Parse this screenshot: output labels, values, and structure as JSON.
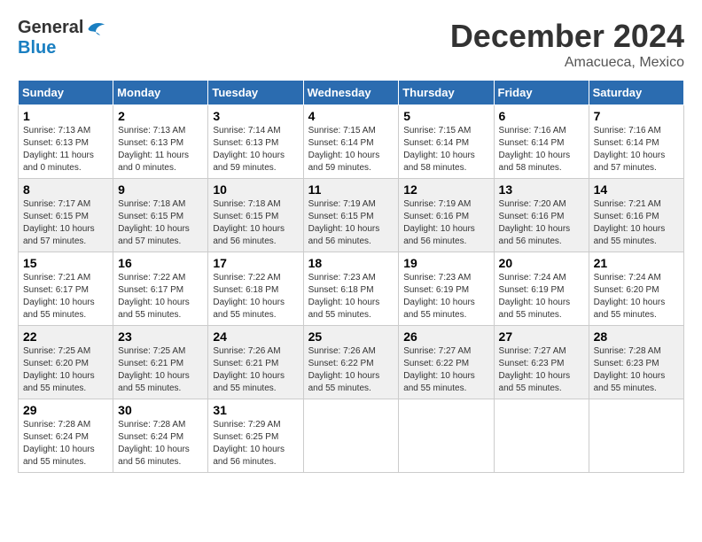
{
  "header": {
    "logo_general": "General",
    "logo_blue": "Blue",
    "title": "December 2024",
    "location": "Amacueca, Mexico"
  },
  "weekdays": [
    "Sunday",
    "Monday",
    "Tuesday",
    "Wednesday",
    "Thursday",
    "Friday",
    "Saturday"
  ],
  "weeks": [
    [
      {
        "day": "1",
        "sunrise": "Sunrise: 7:13 AM",
        "sunset": "Sunset: 6:13 PM",
        "daylight": "Daylight: 11 hours and 0 minutes."
      },
      {
        "day": "2",
        "sunrise": "Sunrise: 7:13 AM",
        "sunset": "Sunset: 6:13 PM",
        "daylight": "Daylight: 11 hours and 0 minutes."
      },
      {
        "day": "3",
        "sunrise": "Sunrise: 7:14 AM",
        "sunset": "Sunset: 6:13 PM",
        "daylight": "Daylight: 10 hours and 59 minutes."
      },
      {
        "day": "4",
        "sunrise": "Sunrise: 7:15 AM",
        "sunset": "Sunset: 6:14 PM",
        "daylight": "Daylight: 10 hours and 59 minutes."
      },
      {
        "day": "5",
        "sunrise": "Sunrise: 7:15 AM",
        "sunset": "Sunset: 6:14 PM",
        "daylight": "Daylight: 10 hours and 58 minutes."
      },
      {
        "day": "6",
        "sunrise": "Sunrise: 7:16 AM",
        "sunset": "Sunset: 6:14 PM",
        "daylight": "Daylight: 10 hours and 58 minutes."
      },
      {
        "day": "7",
        "sunrise": "Sunrise: 7:16 AM",
        "sunset": "Sunset: 6:14 PM",
        "daylight": "Daylight: 10 hours and 57 minutes."
      }
    ],
    [
      {
        "day": "8",
        "sunrise": "Sunrise: 7:17 AM",
        "sunset": "Sunset: 6:15 PM",
        "daylight": "Daylight: 10 hours and 57 minutes."
      },
      {
        "day": "9",
        "sunrise": "Sunrise: 7:18 AM",
        "sunset": "Sunset: 6:15 PM",
        "daylight": "Daylight: 10 hours and 57 minutes."
      },
      {
        "day": "10",
        "sunrise": "Sunrise: 7:18 AM",
        "sunset": "Sunset: 6:15 PM",
        "daylight": "Daylight: 10 hours and 56 minutes."
      },
      {
        "day": "11",
        "sunrise": "Sunrise: 7:19 AM",
        "sunset": "Sunset: 6:15 PM",
        "daylight": "Daylight: 10 hours and 56 minutes."
      },
      {
        "day": "12",
        "sunrise": "Sunrise: 7:19 AM",
        "sunset": "Sunset: 6:16 PM",
        "daylight": "Daylight: 10 hours and 56 minutes."
      },
      {
        "day": "13",
        "sunrise": "Sunrise: 7:20 AM",
        "sunset": "Sunset: 6:16 PM",
        "daylight": "Daylight: 10 hours and 56 minutes."
      },
      {
        "day": "14",
        "sunrise": "Sunrise: 7:21 AM",
        "sunset": "Sunset: 6:16 PM",
        "daylight": "Daylight: 10 hours and 55 minutes."
      }
    ],
    [
      {
        "day": "15",
        "sunrise": "Sunrise: 7:21 AM",
        "sunset": "Sunset: 6:17 PM",
        "daylight": "Daylight: 10 hours and 55 minutes."
      },
      {
        "day": "16",
        "sunrise": "Sunrise: 7:22 AM",
        "sunset": "Sunset: 6:17 PM",
        "daylight": "Daylight: 10 hours and 55 minutes."
      },
      {
        "day": "17",
        "sunrise": "Sunrise: 7:22 AM",
        "sunset": "Sunset: 6:18 PM",
        "daylight": "Daylight: 10 hours and 55 minutes."
      },
      {
        "day": "18",
        "sunrise": "Sunrise: 7:23 AM",
        "sunset": "Sunset: 6:18 PM",
        "daylight": "Daylight: 10 hours and 55 minutes."
      },
      {
        "day": "19",
        "sunrise": "Sunrise: 7:23 AM",
        "sunset": "Sunset: 6:19 PM",
        "daylight": "Daylight: 10 hours and 55 minutes."
      },
      {
        "day": "20",
        "sunrise": "Sunrise: 7:24 AM",
        "sunset": "Sunset: 6:19 PM",
        "daylight": "Daylight: 10 hours and 55 minutes."
      },
      {
        "day": "21",
        "sunrise": "Sunrise: 7:24 AM",
        "sunset": "Sunset: 6:20 PM",
        "daylight": "Daylight: 10 hours and 55 minutes."
      }
    ],
    [
      {
        "day": "22",
        "sunrise": "Sunrise: 7:25 AM",
        "sunset": "Sunset: 6:20 PM",
        "daylight": "Daylight: 10 hours and 55 minutes."
      },
      {
        "day": "23",
        "sunrise": "Sunrise: 7:25 AM",
        "sunset": "Sunset: 6:21 PM",
        "daylight": "Daylight: 10 hours and 55 minutes."
      },
      {
        "day": "24",
        "sunrise": "Sunrise: 7:26 AM",
        "sunset": "Sunset: 6:21 PM",
        "daylight": "Daylight: 10 hours and 55 minutes."
      },
      {
        "day": "25",
        "sunrise": "Sunrise: 7:26 AM",
        "sunset": "Sunset: 6:22 PM",
        "daylight": "Daylight: 10 hours and 55 minutes."
      },
      {
        "day": "26",
        "sunrise": "Sunrise: 7:27 AM",
        "sunset": "Sunset: 6:22 PM",
        "daylight": "Daylight: 10 hours and 55 minutes."
      },
      {
        "day": "27",
        "sunrise": "Sunrise: 7:27 AM",
        "sunset": "Sunset: 6:23 PM",
        "daylight": "Daylight: 10 hours and 55 minutes."
      },
      {
        "day": "28",
        "sunrise": "Sunrise: 7:28 AM",
        "sunset": "Sunset: 6:23 PM",
        "daylight": "Daylight: 10 hours and 55 minutes."
      }
    ],
    [
      {
        "day": "29",
        "sunrise": "Sunrise: 7:28 AM",
        "sunset": "Sunset: 6:24 PM",
        "daylight": "Daylight: 10 hours and 55 minutes."
      },
      {
        "day": "30",
        "sunrise": "Sunrise: 7:28 AM",
        "sunset": "Sunset: 6:24 PM",
        "daylight": "Daylight: 10 hours and 56 minutes."
      },
      {
        "day": "31",
        "sunrise": "Sunrise: 7:29 AM",
        "sunset": "Sunset: 6:25 PM",
        "daylight": "Daylight: 10 hours and 56 minutes."
      },
      null,
      null,
      null,
      null
    ]
  ]
}
